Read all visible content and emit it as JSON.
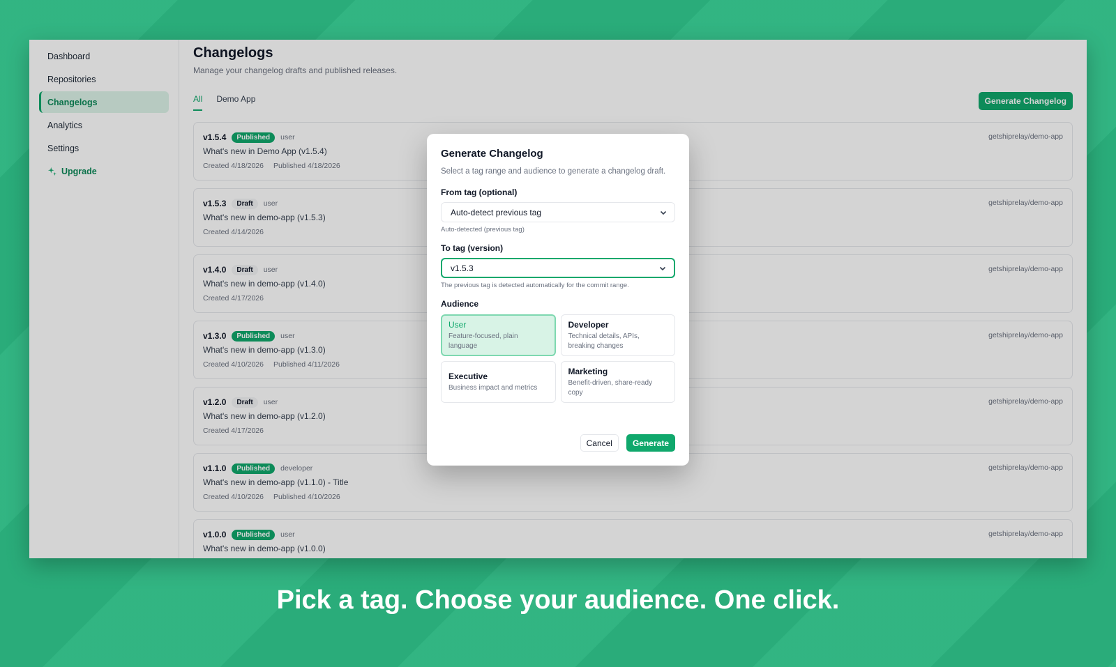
{
  "sidebar": {
    "items": [
      {
        "label": "Dashboard"
      },
      {
        "label": "Repositories"
      },
      {
        "label": "Changelogs"
      },
      {
        "label": "Analytics"
      },
      {
        "label": "Settings"
      }
    ],
    "upgrade_label": "Upgrade",
    "upgrade_icon": "sparkles-icon",
    "active": "Changelogs"
  },
  "header": {
    "title": "Changelogs",
    "subtitle": "Manage your changelog drafts and published releases.",
    "generate_label": "Generate Changelog"
  },
  "tabs": [
    {
      "label": "All",
      "active": true
    },
    {
      "label": "Demo App",
      "active": false
    }
  ],
  "changelogs": [
    {
      "version": "v1.5.4",
      "status": "Published",
      "audience": "user",
      "title": "What's new in Demo App (v1.5.4)",
      "created": "Created 4/18/2026",
      "published": "Published 4/18/2026",
      "repo": "getshiprelay/demo-app"
    },
    {
      "version": "v1.5.3",
      "status": "Draft",
      "audience": "user",
      "title": "What's new in demo-app (v1.5.3)",
      "created": "Created 4/14/2026",
      "published": "",
      "repo": "getshiprelay/demo-app"
    },
    {
      "version": "v1.4.0",
      "status": "Draft",
      "audience": "user",
      "title": "What's new in demo-app (v1.4.0)",
      "created": "Created 4/17/2026",
      "published": "",
      "repo": "getshiprelay/demo-app"
    },
    {
      "version": "v1.3.0",
      "status": "Published",
      "audience": "user",
      "title": "What's new in demo-app (v1.3.0)",
      "created": "Created 4/10/2026",
      "published": "Published 4/11/2026",
      "repo": "getshiprelay/demo-app"
    },
    {
      "version": "v1.2.0",
      "status": "Draft",
      "audience": "user",
      "title": "What's new in demo-app (v1.2.0)",
      "created": "Created 4/17/2026",
      "published": "",
      "repo": "getshiprelay/demo-app"
    },
    {
      "version": "v1.1.0",
      "status": "Published",
      "audience": "developer",
      "title": "What's new in demo-app (v1.1.0) - Title",
      "created": "Created 4/10/2026",
      "published": "Published 4/10/2026",
      "repo": "getshiprelay/demo-app"
    },
    {
      "version": "v1.0.0",
      "status": "Published",
      "audience": "user",
      "title": "What's new in demo-app (v1.0.0)",
      "created": "",
      "published": "",
      "repo": "getshiprelay/demo-app"
    }
  ],
  "modal": {
    "title": "Generate Changelog",
    "description": "Select a tag range and audience to generate a changelog draft.",
    "from_label": "From tag (optional)",
    "from_value": "Auto-detect previous tag",
    "from_hint": "Auto-detected (previous tag)",
    "to_label": "To tag (version)",
    "to_value": "v1.5.3",
    "to_hint": "The previous tag is detected automatically for the commit range.",
    "audience_label": "Audience",
    "audiences": [
      {
        "name": "User",
        "desc": "Feature-focused, plain language",
        "selected": true
      },
      {
        "name": "Developer",
        "desc": "Technical details, APIs, breaking changes",
        "selected": false
      },
      {
        "name": "Executive",
        "desc": "Business impact and metrics",
        "selected": false
      },
      {
        "name": "Marketing",
        "desc": "Benefit-driven, share-ready copy",
        "selected": false
      }
    ],
    "cancel_label": "Cancel",
    "generate_label": "Generate"
  },
  "caption": "Pick a tag. Choose your audience. One click.",
  "colors": {
    "background": "#2bb27e",
    "accent": "#10a86c",
    "selected_bg": "#d8f3e6"
  }
}
